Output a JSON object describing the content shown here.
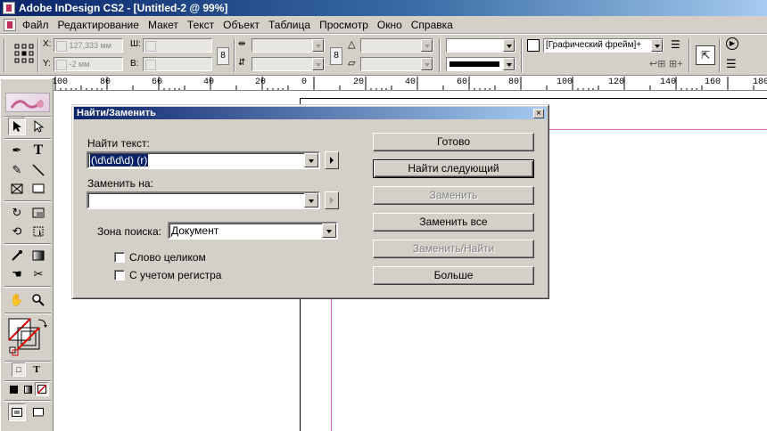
{
  "window": {
    "title": "Adobe InDesign CS2 - [Untitled-2 @ 99%]"
  },
  "menu": [
    "Файл",
    "Редактирование",
    "Макет",
    "Текст",
    "Объект",
    "Таблица",
    "Просмотр",
    "Окно",
    "Справка"
  ],
  "control": {
    "x_label": "X:",
    "x_value": "127,333 мм",
    "y_label": "Y:",
    "y_value": "-2 мм",
    "w_label": "Ш:",
    "h_label": "В:",
    "object_style": "[Графический фрейм]+"
  },
  "ruler": [
    "100",
    "80",
    "60",
    "40",
    "20",
    "0",
    "20",
    "40",
    "60",
    "80",
    "100",
    "120",
    "140",
    "160",
    "180"
  ],
  "dialog": {
    "title": "Найти/Заменить",
    "find_label": "Найти текст:",
    "find_value": "(\\d\\d\\d\\d) (r)",
    "replace_label": "Заменить на:",
    "replace_value": "",
    "scope_label": "Зона поиска:",
    "scope_value": "Документ",
    "whole_word": "Слово целиком",
    "case_sensitive": "С учетом регистра",
    "buttons": {
      "done": "Готово",
      "find_next": "Найти следующий",
      "replace": "Заменить",
      "replace_all": "Заменить все",
      "replace_find": "Заменить/Найти",
      "more": "Больше"
    }
  }
}
